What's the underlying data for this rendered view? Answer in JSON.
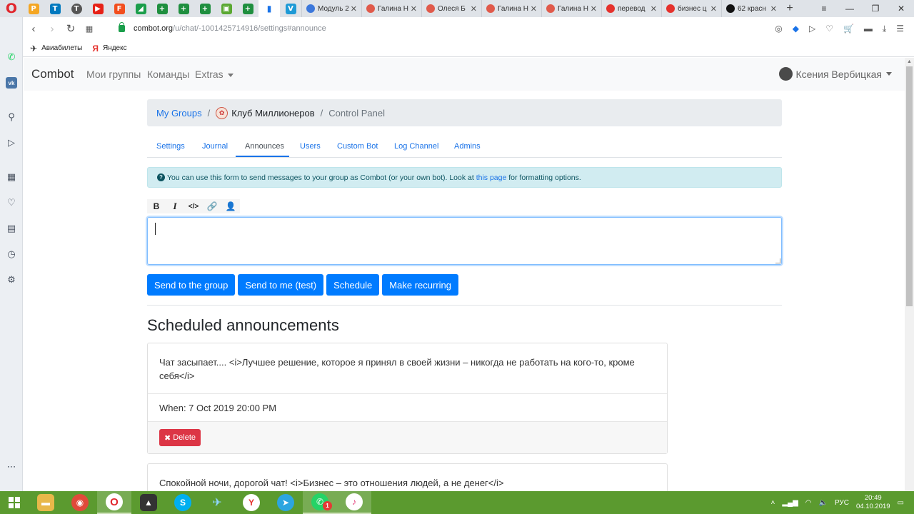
{
  "tabs": {
    "items": [
      {
        "title": "Модуль 2",
        "color": "#3b77db"
      },
      {
        "title": "Галина Н",
        "color": "#e05a4b"
      },
      {
        "title": "Олеся Б",
        "color": "#e05a4b"
      },
      {
        "title": "Галина Н",
        "color": "#e05a4b"
      },
      {
        "title": "Галина Н",
        "color": "#e05a4b"
      },
      {
        "title": "перевод",
        "color": "#e5322d"
      },
      {
        "title": "бизнес ц",
        "color": "#e5322d"
      },
      {
        "title": "62 красн",
        "color": "#111111"
      }
    ]
  },
  "address": {
    "host": "combot.org",
    "path": "/u/chat/-1001425714916/settings#announce"
  },
  "bookmarks": [
    {
      "label": "Авиабилеты",
      "icon": "plane-icon"
    },
    {
      "label": "Яндекс",
      "icon": "yandex-icon"
    }
  ],
  "navbar": {
    "brand": "Combot",
    "links": [
      "Мои группы",
      "Команды",
      "Extras"
    ],
    "user": "Ксения Вербицкая"
  },
  "breadcrumb": {
    "root": "My Groups",
    "group": "Клуб Миллионеров",
    "current": "Control Panel"
  },
  "settings_tabs": [
    "Settings",
    "Journal",
    "Announces",
    "Users",
    "Custom Bot",
    "Log Channel",
    "Admins"
  ],
  "active_tab": "Announces",
  "info": {
    "text_before": "You can use this form to send messages to your group as Combot (or your own bot). Look at ",
    "link": "this page",
    "text_after": " for formatting options."
  },
  "editor_toolbar": [
    "B",
    "I",
    "</>"
  ],
  "editor": {
    "value": ""
  },
  "buttons": {
    "send_group": "Send to the group",
    "send_me": "Send to me (test)",
    "schedule": "Schedule",
    "recurring": "Make recurring"
  },
  "scheduled": {
    "title": "Scheduled announcements",
    "items": [
      {
        "text": "Чат засыпает.... <i>Лучшее решение, которое я принял в своей жизни – никогда не работать на кого-то, кроме себя</i>",
        "when": "When: 7 Oct 2019 20:00 PM",
        "delete": "Delete"
      },
      {
        "text": "Спокойной ночи, дорогой чат! <i>Бизнес – это отношения людей, а не денег</i>"
      }
    ]
  },
  "taskbar": {
    "lang": "РУС",
    "time": "20:49",
    "date": "04.10.2019",
    "whatsapp_badge": "1"
  },
  "colors": {
    "primary": "#007bff",
    "danger": "#dc3545",
    "info_bg": "#d1ecf1",
    "taskbar": "#5b9a2f"
  }
}
